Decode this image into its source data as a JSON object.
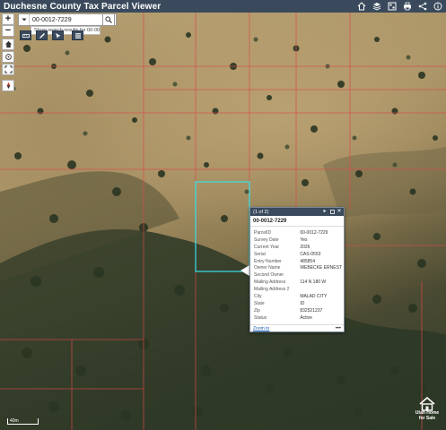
{
  "header": {
    "title": "Duchesne County Tax Parcel Viewer",
    "tools": [
      {
        "icon": "home-icon"
      },
      {
        "icon": "layers-icon"
      },
      {
        "icon": "basemap-icon"
      },
      {
        "icon": "print-icon"
      },
      {
        "icon": "share-icon"
      },
      {
        "icon": "info-icon"
      }
    ]
  },
  "search": {
    "value": "00-0012-7229",
    "suggestion": "Show search results for 00-00..."
  },
  "popup": {
    "counter": "(1 of 2)",
    "title": "00-0012-7229",
    "fields": [
      {
        "label": "ParcelID",
        "value": "00-0012-7229"
      },
      {
        "label": "Survey Date",
        "value": "Yes"
      },
      {
        "label": "Current Year",
        "value": "2026"
      },
      {
        "label": "Serial",
        "value": "CAS-0553"
      },
      {
        "label": "Entry Number",
        "value": "485854"
      },
      {
        "label": "Owner Name",
        "value": "WEBECKE ERNEST"
      },
      {
        "label": "Second Owner",
        "value": ""
      },
      {
        "label": "Mailing Address",
        "value": "114 N 180 W"
      },
      {
        "label": "Mailing Address 2",
        "value": ""
      },
      {
        "label": "City",
        "value": "MALAD CITY"
      },
      {
        "label": "State",
        "value": "ID"
      },
      {
        "label": "Zip",
        "value": "832521237"
      },
      {
        "label": "Status",
        "value": "Active"
      }
    ],
    "zoom_label": "Zoom to",
    "more_label": "•••"
  },
  "map": {
    "scale_label": "40m",
    "logo_text_line1": "Utah Home",
    "logo_text_line2": "for Sale"
  },
  "colors": {
    "header_bg": "#3a4a5c",
    "parcel_line": "#d94a4a",
    "selected_parcel": "#38e0e8"
  }
}
